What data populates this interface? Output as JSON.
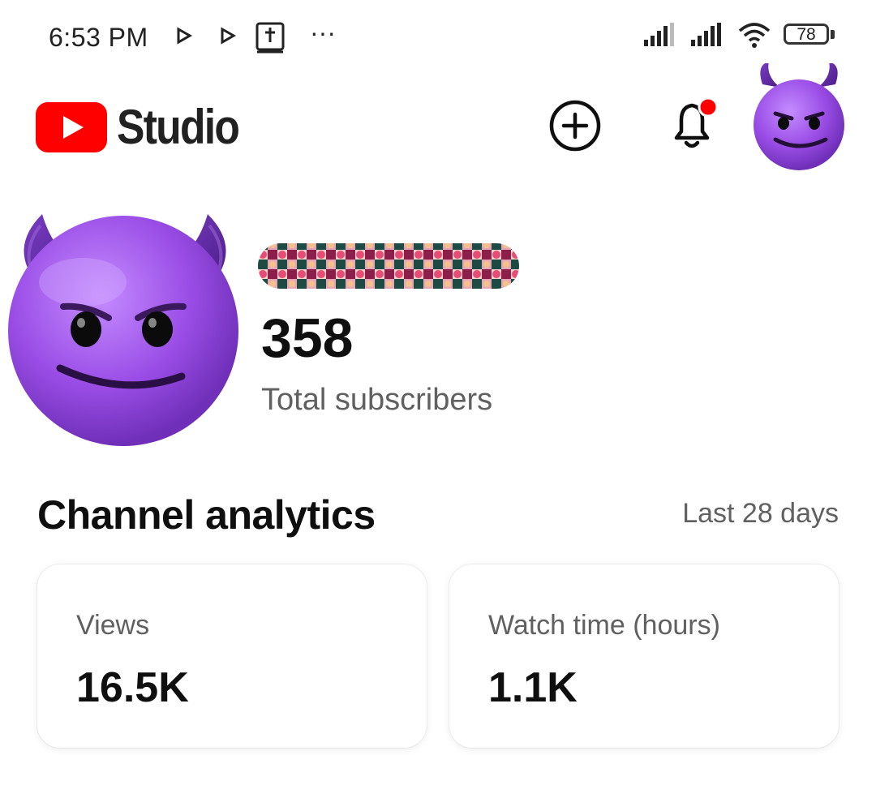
{
  "status_bar": {
    "time": "6:53 PM",
    "more": "···",
    "battery": "78",
    "icons": [
      "play-notification-icon",
      "play-notification-icon",
      "bible-app-icon",
      "signal-icon",
      "signal-icon",
      "wifi-icon",
      "battery-icon"
    ]
  },
  "app_bar": {
    "logo_text": "Studio",
    "brand_color": "#ff0000"
  },
  "channel": {
    "subscribers": "358",
    "subscribers_label": "Total subscribers"
  },
  "analytics": {
    "title": "Channel analytics",
    "range": "Last 28 days",
    "cards": [
      {
        "label": "Views",
        "value": "16.5K"
      },
      {
        "label": "Watch time (hours)",
        "value": "1.1K"
      }
    ]
  },
  "colors": {
    "notification_dot": "#ff0000",
    "avatar_purple": "#9b4ee0"
  }
}
